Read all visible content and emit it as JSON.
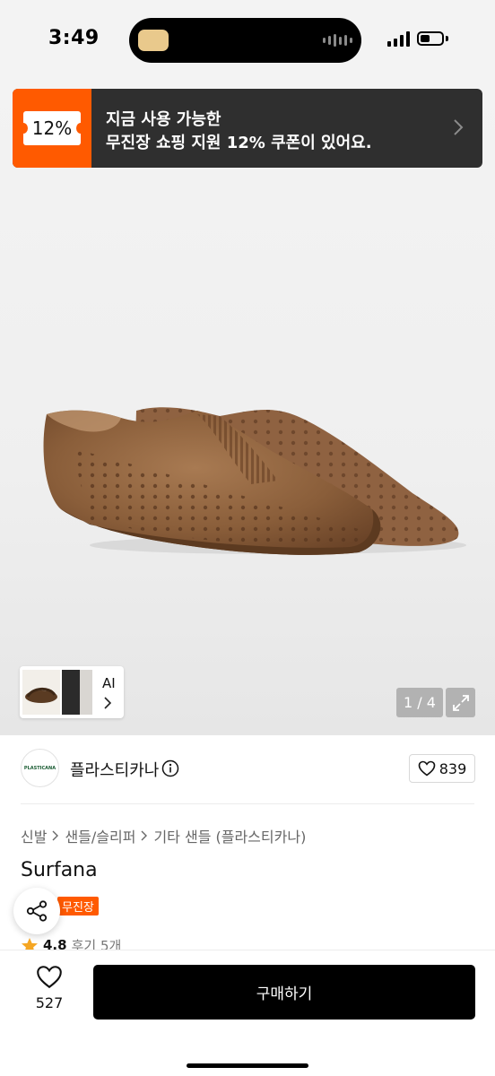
{
  "status_bar": {
    "time": "3:49",
    "icons": [
      "media-app-icon",
      "audio-wave-icon",
      "signal-icon",
      "battery-icon"
    ],
    "battery_level": 0.45
  },
  "coupon": {
    "rate": "12%",
    "line1": "지금 사용 가능한",
    "line2": "무진장 쇼핑 지원 12% 쿠폰이 있어요.",
    "accent_color": "#ff5a00",
    "background_color": "#2f2f2f"
  },
  "gallery": {
    "ai_label": "AI",
    "page_indicator": "1 / 4"
  },
  "brand": {
    "logo_text": "PLASTICANA",
    "name": "플라스티카나",
    "like_count": "839"
  },
  "breadcrumb": [
    "신발",
    "샌들/슬리퍼",
    "기타 샌들 (플라스티카나)"
  ],
  "product": {
    "title": "Surfana",
    "badge": "무진장",
    "rating": "4.8",
    "reviews": "후기 5개"
  },
  "bottom_bar": {
    "wish_count": "527",
    "buy_label": "구매하기"
  }
}
